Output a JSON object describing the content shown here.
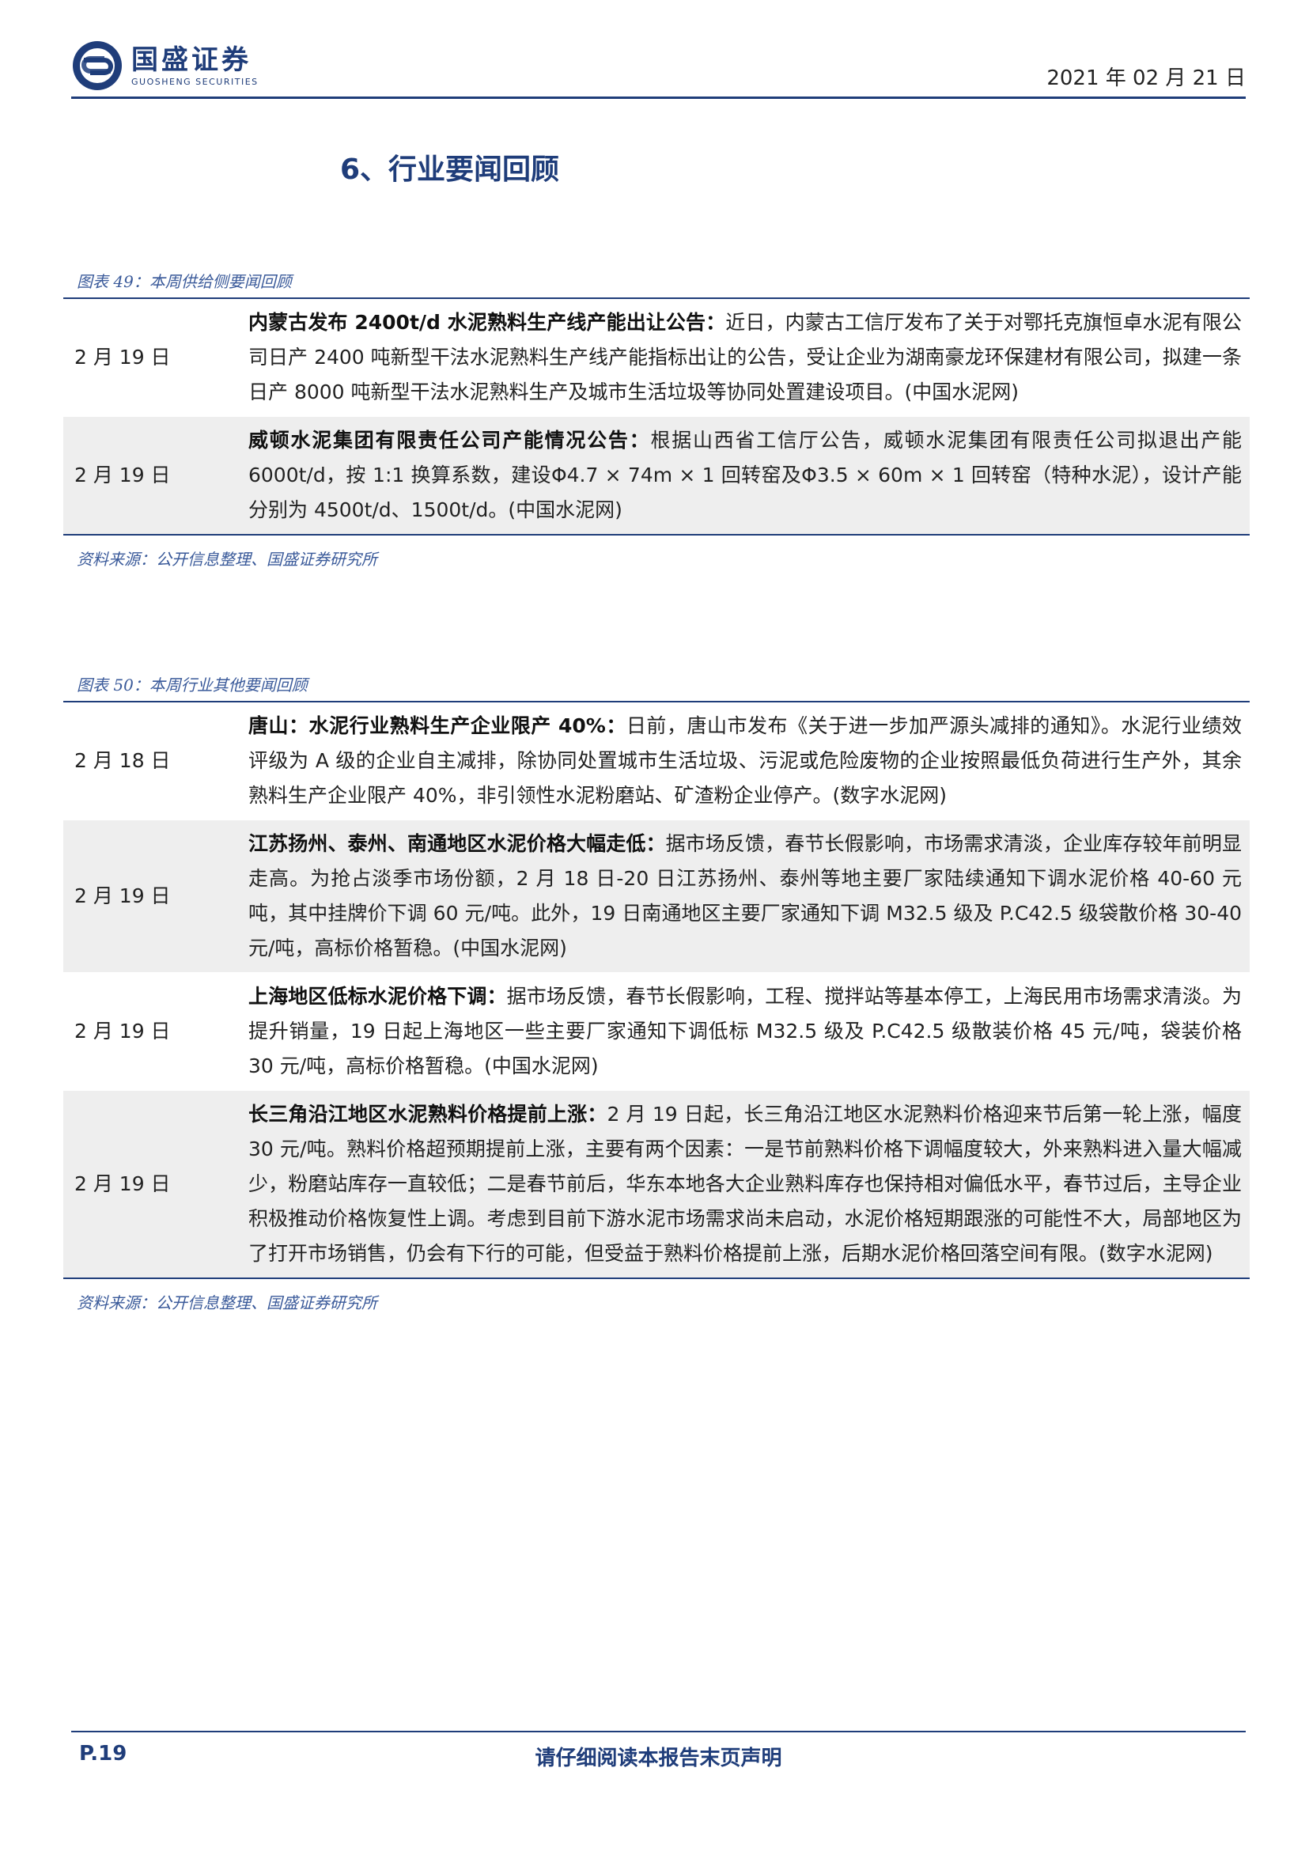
{
  "header": {
    "logo_cn": "国盛证券",
    "logo_en": "GUOSHENG SECURITIES",
    "date": "2021 年 02 月 21 日"
  },
  "section_title": "6、行业要闻回顾",
  "table49": {
    "caption": "图表 49：本周供给侧要闻回顾",
    "rows": [
      {
        "date": "2 月 19 日",
        "headline": "内蒙古发布 2400t/d 水泥熟料生产线产能出让公告：",
        "body": "近日，内蒙古工信厅发布了关于对鄂托克旗恒卓水泥有限公司日产 2400 吨新型干法水泥熟料生产线产能指标出让的公告，受让企业为湖南豪龙环保建材有限公司，拟建一条日产 8000 吨新型干法水泥熟料生产及城市生活垃圾等协同处置建设项目。(中国水泥网)"
      },
      {
        "date": "2 月 19 日",
        "headline": "威顿水泥集团有限责任公司产能情况公告：",
        "body": "根据山西省工信厅公告，威顿水泥集团有限责任公司拟退出产能 6000t/d，按 1:1 换算系数，建设Φ4.7 × 74m × 1 回转窑及Φ3.5 × 60m × 1 回转窑（特种水泥），设计产能分别为 4500t/d、1500t/d。(中国水泥网)"
      }
    ],
    "source": "资料来源：公开信息整理、国盛证券研究所"
  },
  "table50": {
    "caption": "图表 50：本周行业其他要闻回顾",
    "rows": [
      {
        "date": "2 月 18 日",
        "headline": "唐山：水泥行业熟料生产企业限产 40%：",
        "body": "日前，唐山市发布《关于进一步加严源头减排的通知》。水泥行业绩效评级为 A 级的企业自主减排，除协同处置城市生活垃圾、污泥或危险废物的企业按照最低负荷进行生产外，其余熟料生产企业限产 40%，非引领性水泥粉磨站、矿渣粉企业停产。(数字水泥网)"
      },
      {
        "date": "2 月 19 日",
        "headline": "江苏扬州、泰州、南通地区水泥价格大幅走低：",
        "body": "据市场反馈，春节长假影响，市场需求清淡，企业库存较年前明显走高。为抢占淡季市场份额，2 月 18 日-20 日江苏扬州、泰州等地主要厂家陆续通知下调水泥价格 40-60 元吨，其中挂牌价下调 60 元/吨。此外，19 日南通地区主要厂家通知下调 M32.5 级及 P.C42.5 级袋散价格 30-40 元/吨，高标价格暂稳。(中国水泥网)"
      },
      {
        "date": "2 月 19 日",
        "headline": "上海地区低标水泥价格下调：",
        "body": "据市场反馈，春节长假影响，工程、搅拌站等基本停工，上海民用市场需求清淡。为提升销量，19 日起上海地区一些主要厂家通知下调低标 M32.5 级及 P.C42.5 级散装价格 45 元/吨，袋装价格 30 元/吨，高标价格暂稳。(中国水泥网)"
      },
      {
        "date": "2 月 19 日",
        "headline": "长三角沿江地区水泥熟料价格提前上涨：",
        "body": "2 月 19 日起，长三角沿江地区水泥熟料价格迎来节后第一轮上涨，幅度 30 元/吨。熟料价格超预期提前上涨，主要有两个因素：一是节前熟料价格下调幅度较大，外来熟料进入量大幅减少，粉磨站库存一直较低；二是春节前后，华东本地各大企业熟料库存也保持相对偏低水平，春节过后，主导企业积极推动价格恢复性上调。考虑到目前下游水泥市场需求尚未启动，水泥价格短期跟涨的可能性不大，局部地区为了打开市场销售，仍会有下行的可能，但受益于熟料价格提前上涨，后期水泥价格回落空间有限。(数字水泥网)"
      }
    ],
    "source": "资料来源：公开信息整理、国盛证券研究所"
  },
  "footer": {
    "page": "P.19",
    "disclaimer": "请仔细阅读本报告末页声明"
  }
}
